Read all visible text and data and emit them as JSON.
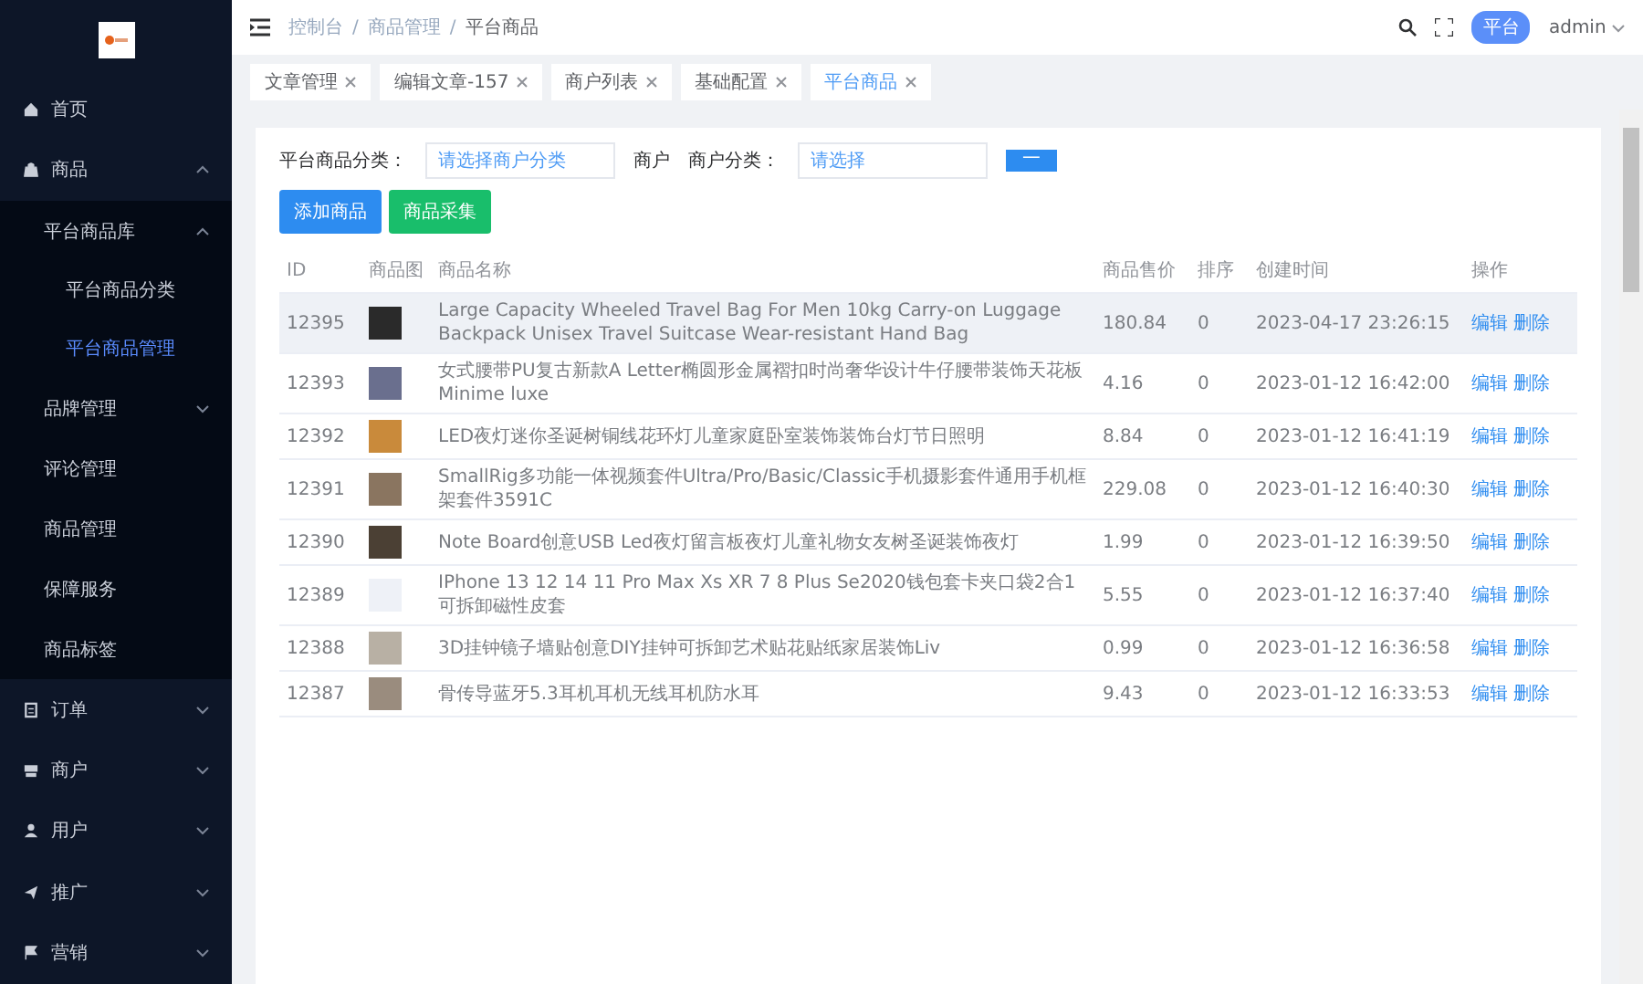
{
  "sidebar": {
    "items": [
      {
        "label": "首页",
        "selected": false
      },
      {
        "label": "商品",
        "selected": false,
        "expanded": true,
        "children": [
          {
            "label": "平台商品库",
            "selected": false,
            "expanded": true,
            "children": [
              {
                "label": "平台商品分类",
                "selected": false
              },
              {
                "label": "平台商品管理",
                "selected": true
              }
            ]
          },
          {
            "label": "品牌管理",
            "selected": false,
            "expanded": false
          },
          {
            "label": "评论管理",
            "selected": false
          },
          {
            "label": "商品管理",
            "selected": false
          },
          {
            "label": "保障服务",
            "selected": false
          },
          {
            "label": "商品标签",
            "selected": false
          }
        ]
      },
      {
        "label": "订单",
        "selected": false,
        "expanded": false
      },
      {
        "label": "商户",
        "selected": false,
        "expanded": false
      },
      {
        "label": "用户",
        "selected": false,
        "expanded": false
      },
      {
        "label": "推广",
        "selected": false,
        "expanded": false
      },
      {
        "label": "营销",
        "selected": false,
        "expanded": false
      }
    ]
  },
  "header": {
    "breadcrumb": [
      "控制台",
      "商品管理",
      "平台商品"
    ],
    "separator": "/",
    "role_badge": "平台",
    "user": "admin"
  },
  "tabs": [
    {
      "label": "文章管理",
      "selected": false
    },
    {
      "label": "编辑文章-157",
      "selected": false
    },
    {
      "label": "商户列表",
      "selected": false
    },
    {
      "label": "基础配置",
      "selected": false
    },
    {
      "label": "平台商品",
      "selected": true
    }
  ],
  "filter": {
    "label": "平台商品分类：",
    "field_1": "请选择商户分类",
    "label_2": "商户",
    "label_3": "商户分类：",
    "field_2": "请选择",
    "search_button": "一"
  },
  "actions": [
    "添加商品",
    "商品采集"
  ],
  "table": {
    "columns": [
      "ID",
      "商品图",
      "商品名称",
      "商品售价",
      "排序",
      "创建时间",
      "操作"
    ],
    "rows": [
      {
        "id": "12395",
        "name": "Large Capacity Wheeled Travel Bag For Men 10kg Carry-on Luggage Backpack Unisex Travel Suitcase Wear-resistant Hand Bag",
        "price": "180.84",
        "sort": "0",
        "created": "2023-04-17 23:26:15",
        "edit": "编辑",
        "delete": "删除",
        "highlighted": true
      },
      {
        "id": "12393",
        "name": "女式腰带PU复古新款A Letter椭圆形金属褶扣时尚奢华设计牛仔腰带装饰天花板Minime luxe",
        "price": "4.16",
        "sort": "0",
        "created": "2023-01-12 16:42:00",
        "edit": "编辑",
        "delete": "删除",
        "highlighted": false
      },
      {
        "id": "12392",
        "name": "LED夜灯迷你圣诞树铜线花环灯儿童家庭卧室装饰装饰台灯节日照明",
        "price": "8.84",
        "sort": "0",
        "created": "2023-01-12 16:41:19",
        "edit": "编辑",
        "delete": "删除",
        "highlighted": false
      },
      {
        "id": "12391",
        "name": "SmallRig多功能一体视频套件Ultra/Pro/Basic/Classic手机摄影套件通用手机框架套件3591C",
        "price": "229.08",
        "sort": "0",
        "created": "2023-01-12 16:40:30",
        "edit": "编辑",
        "delete": "删除",
        "highlighted": false
      },
      {
        "id": "12390",
        "name": "Note Board创意USB Led夜灯留言板夜灯儿童礼物女友树圣诞装饰夜灯",
        "price": "1.99",
        "sort": "0",
        "created": "2023-01-12 16:39:50",
        "edit": "编辑",
        "delete": "删除",
        "highlighted": false
      },
      {
        "id": "12389",
        "name": "IPhone 13 12 14 11 Pro Max Xs XR 7 8 Plus Se2020钱包套卡夹口袋2合1可拆卸磁性皮套",
        "price": "5.55",
        "sort": "0",
        "created": "2023-01-12 16:37:40",
        "edit": "编辑",
        "delete": "删除",
        "highlighted": false
      },
      {
        "id": "12388",
        "name": "3D挂钟镜子墙贴创意DIY挂钟可拆卸艺术贴花贴纸家居装饰Liv",
        "price": "0.99",
        "sort": "0",
        "created": "2023-01-12 16:36:58",
        "edit": "编辑",
        "delete": "删除",
        "highlighted": false
      },
      {
        "id": "12387",
        "name": "骨传导蓝牙5.3耳机耳机无线耳机防水耳",
        "price": "9.43",
        "sort": "0",
        "created": "2023-01-12 16:33:53",
        "edit": "编辑",
        "delete": "删除",
        "highlighted": false
      }
    ]
  }
}
